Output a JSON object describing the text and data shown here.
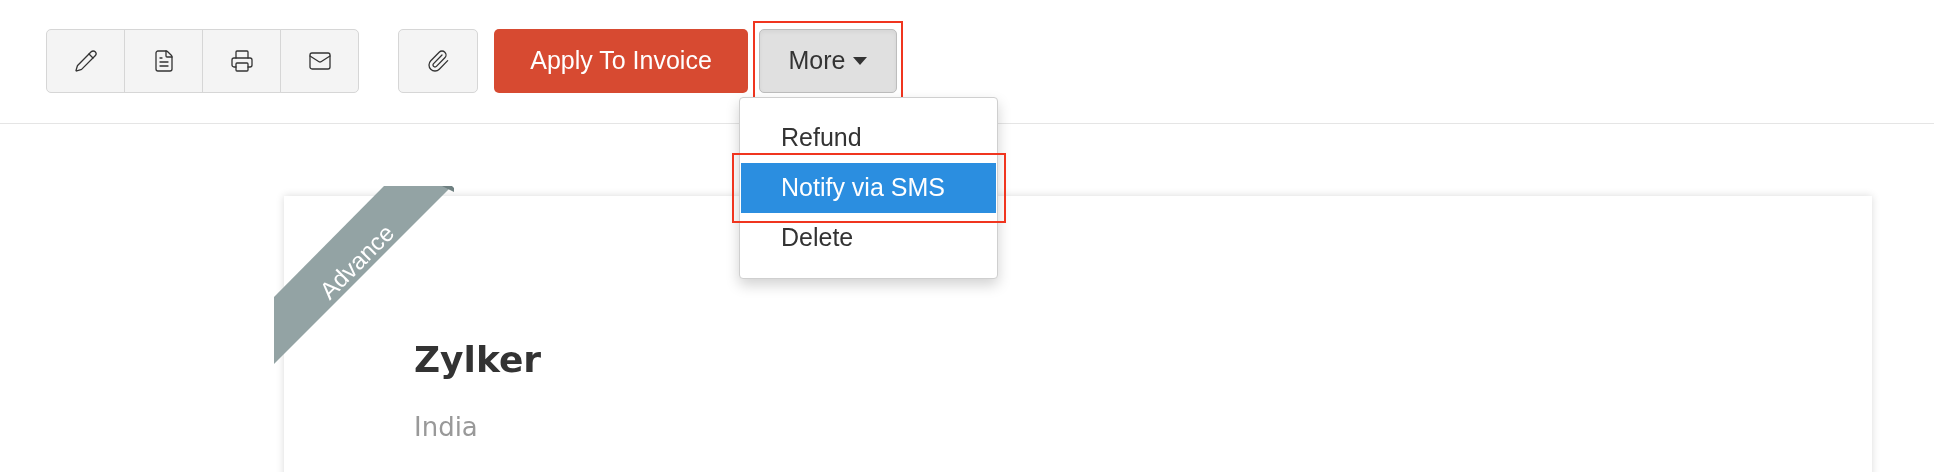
{
  "toolbar": {
    "icon_group": [
      {
        "kind": "edit"
      },
      {
        "kind": "pdf"
      },
      {
        "kind": "print"
      },
      {
        "kind": "email"
      }
    ],
    "attach": {
      "kind": "attach"
    },
    "primary_button": "Apply To Invoice",
    "more_button": {
      "label": "More",
      "expanded": true
    }
  },
  "more_menu": [
    {
      "label": "Refund",
      "selected": false
    },
    {
      "label": "Notify via SMS",
      "selected": true
    },
    {
      "label": "Delete",
      "selected": false
    }
  ],
  "card": {
    "ribbon": "Advance",
    "name": "Zylker",
    "country": "India"
  }
}
